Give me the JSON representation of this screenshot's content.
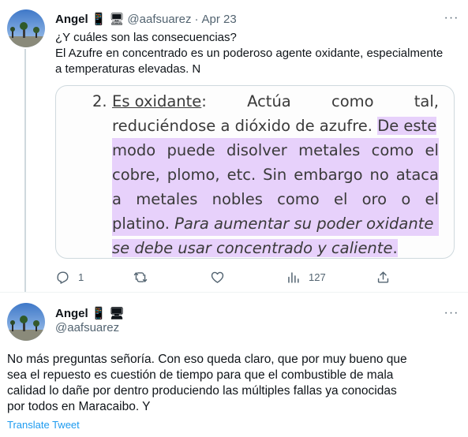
{
  "tweet1": {
    "name": "Angel",
    "emoji": [
      "📱",
      "🖥"
    ],
    "handle": "@aafsuarez",
    "separator": "·",
    "date": "Apr 23",
    "more": "···",
    "text_lines": [
      "¿Y cuáles son las consecuencias?",
      "El Azufre en concentrado es un poderoso agente oxidante, especialmente",
      "a temperaturas elevadas. N"
    ],
    "image_text": {
      "number": "2.",
      "line1": [
        "Es oxidante",
        ":",
        "Actúa",
        "como",
        "tal,"
      ],
      "line2a": "reduciéndose a dióxido de azufre. ",
      "line2b": "De este",
      "line3": [
        "modo",
        "puede",
        "disolver",
        "metales",
        "como",
        "el"
      ],
      "line4": [
        "cobre,",
        "plomo,",
        "etc.",
        "Sin",
        "embargo",
        "no",
        "ataca"
      ],
      "line5": [
        "a",
        "metales",
        "nobles",
        "como",
        "el",
        "oro",
        "o",
        "el"
      ],
      "line6a": "platino. ",
      "line6b": "Para aumentar su poder oxidante",
      "line7": "se debe usar concentrado y caliente",
      "line7end": "."
    },
    "actions": {
      "reply_count": "1",
      "retweet_count": "",
      "like_count": "",
      "view_count": "127"
    }
  },
  "tweet2": {
    "name": "Angel",
    "emoji": [
      "📱",
      "🖥"
    ],
    "handle": "@aafsuarez",
    "more": "···",
    "text_lines": [
      "No más preguntas señoría. Con eso queda claro, que por muy bueno que",
      "sea el repuesto es cuestión de tiempo para que el combustible de mala",
      "calidad lo dañe por dentro produciendo las múltiples fallas ya conocidas",
      "por todos en Maracaibo. Y"
    ],
    "translate_label": "Translate Tweet"
  },
  "colors": {
    "text": "#0f1419",
    "secondary": "#536471",
    "link": "#1d9bf0",
    "highlight": "#e7d1fb",
    "border": "#cfd9de"
  }
}
